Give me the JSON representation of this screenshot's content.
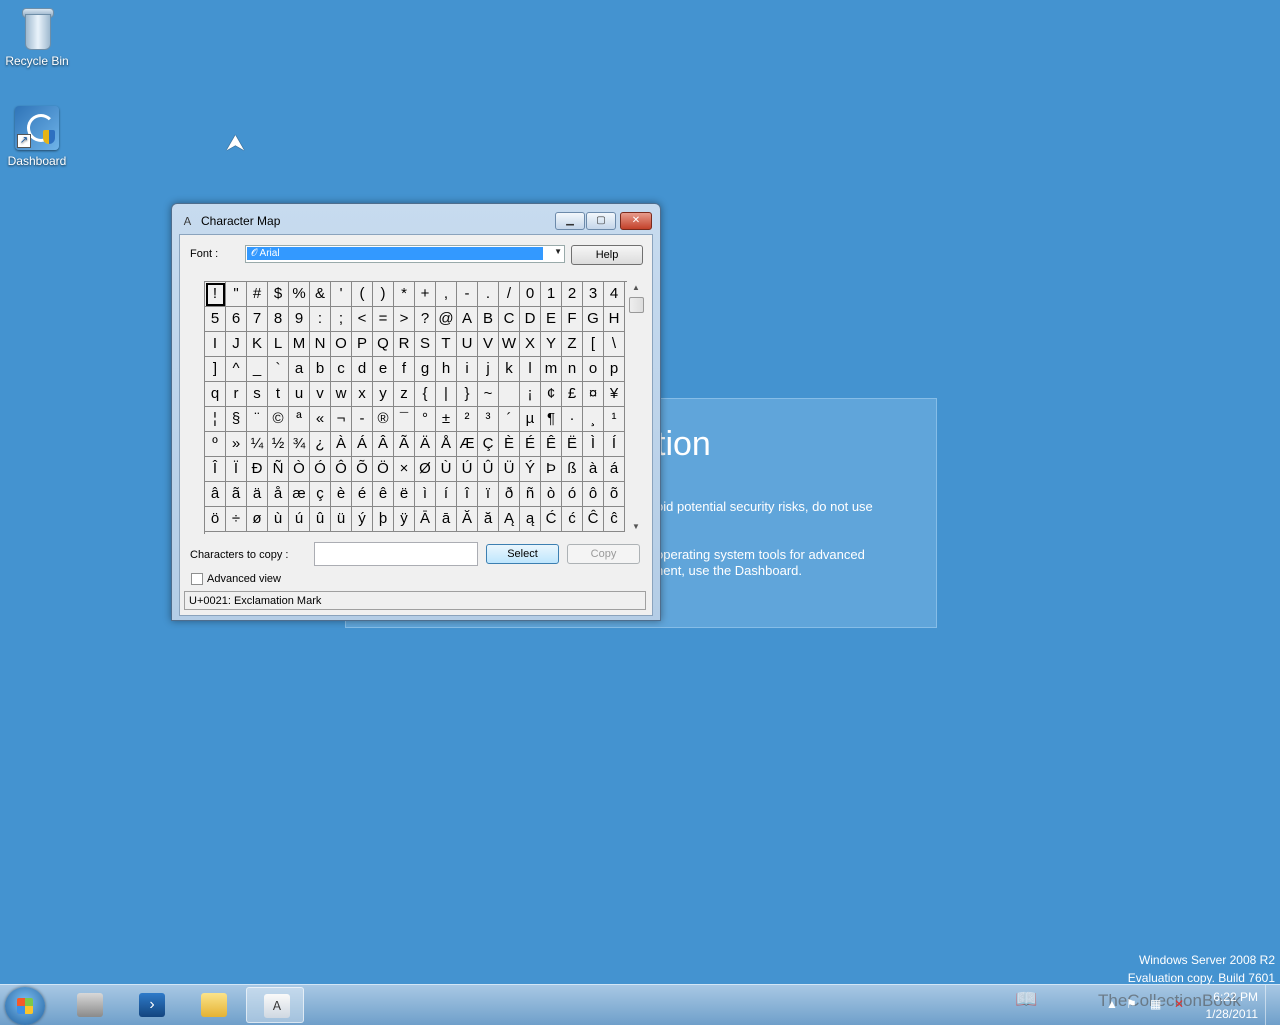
{
  "desktop": {
    "icons": [
      {
        "label": "Recycle Bin",
        "icon": "recycle-bin-icon"
      },
      {
        "label": "Dashboard",
        "icon": "dashboard-icon"
      }
    ],
    "background_panel": {
      "heading": "tion",
      "line1": "oid potential security risks, do not use",
      "line2": "operating system tools for advanced",
      "line3": "nent, use the Dashboard."
    }
  },
  "window": {
    "title": "Character Map",
    "buttons": {
      "minimize": "▁",
      "maximize": "▢",
      "close": "✕"
    },
    "font_label": "Font :",
    "font_value": "Arial",
    "help_label": "Help",
    "characters": [
      "!",
      "\"",
      "#",
      "$",
      "%",
      "&",
      "'",
      "(",
      ")",
      "*",
      "+",
      ",",
      "-",
      ".",
      "/",
      "0",
      "1",
      "2",
      "3",
      "4",
      "5",
      "6",
      "7",
      "8",
      "9",
      ":",
      ";",
      "<",
      "=",
      ">",
      "?",
      "@",
      "A",
      "B",
      "C",
      "D",
      "E",
      "F",
      "G",
      "H",
      "I",
      "J",
      "K",
      "L",
      "M",
      "N",
      "O",
      "P",
      "Q",
      "R",
      "S",
      "T",
      "U",
      "V",
      "W",
      "X",
      "Y",
      "Z",
      "[",
      "\\",
      "]",
      "^",
      "_",
      "`",
      "a",
      "b",
      "c",
      "d",
      "e",
      "f",
      "g",
      "h",
      "i",
      "j",
      "k",
      "l",
      "m",
      "n",
      "o",
      "p",
      "q",
      "r",
      "s",
      "t",
      "u",
      "v",
      "w",
      "x",
      "y",
      "z",
      "{",
      "|",
      "}",
      "~",
      " ",
      "¡",
      "¢",
      "£",
      "¤",
      "¥",
      "¦",
      "§",
      "¨",
      "©",
      "ª",
      "«",
      "¬",
      "-",
      "®",
      "¯",
      "°",
      "±",
      "²",
      "³",
      "´",
      "µ",
      "¶",
      "·",
      "¸",
      "¹",
      "º",
      "»",
      "¼",
      "½",
      "¾",
      "¿",
      "À",
      "Á",
      "Â",
      "Ã",
      "Ä",
      "Å",
      "Æ",
      "Ç",
      "È",
      "É",
      "Ê",
      "Ë",
      "Ì",
      "Í",
      "Î",
      "Ï",
      "Ð",
      "Ñ",
      "Ò",
      "Ó",
      "Ô",
      "Õ",
      "Ö",
      "×",
      "Ø",
      "Ù",
      "Ú",
      "Û",
      "Ü",
      "Ý",
      "Þ",
      "ß",
      "à",
      "á",
      "â",
      "ã",
      "ä",
      "å",
      "æ",
      "ç",
      "è",
      "é",
      "ê",
      "ë",
      "ì",
      "í",
      "î",
      "ï",
      "ð",
      "ñ",
      "ò",
      "ó",
      "ô",
      "õ",
      "ö",
      "÷",
      "ø",
      "ù",
      "ú",
      "û",
      "ü",
      "ý",
      "þ",
      "ÿ",
      "Ā",
      "ā",
      "Ă",
      "ă",
      "Ą",
      "ą",
      "Ć",
      "ć",
      "Ĉ",
      "ĉ"
    ],
    "chars_to_copy_label": "Characters to copy :",
    "chars_to_copy_value": "",
    "select_label": "Select",
    "copy_label": "Copy",
    "advanced_view_label": "Advanced view",
    "advanced_view_checked": false,
    "status_text": "U+0021: Exclamation Mark"
  },
  "watermark": {
    "line1": "Windows Server 2008 R2",
    "line2": "Evaluation copy. Build 7601"
  },
  "taskbar": {
    "items": [
      "server-manager-icon",
      "powershell-icon",
      "explorer-folder-icon",
      "character-map-icon"
    ],
    "tray_overlay": "TheCollectionBook",
    "clock_time": "6:22 PM",
    "clock_date": "1/28/2011"
  }
}
